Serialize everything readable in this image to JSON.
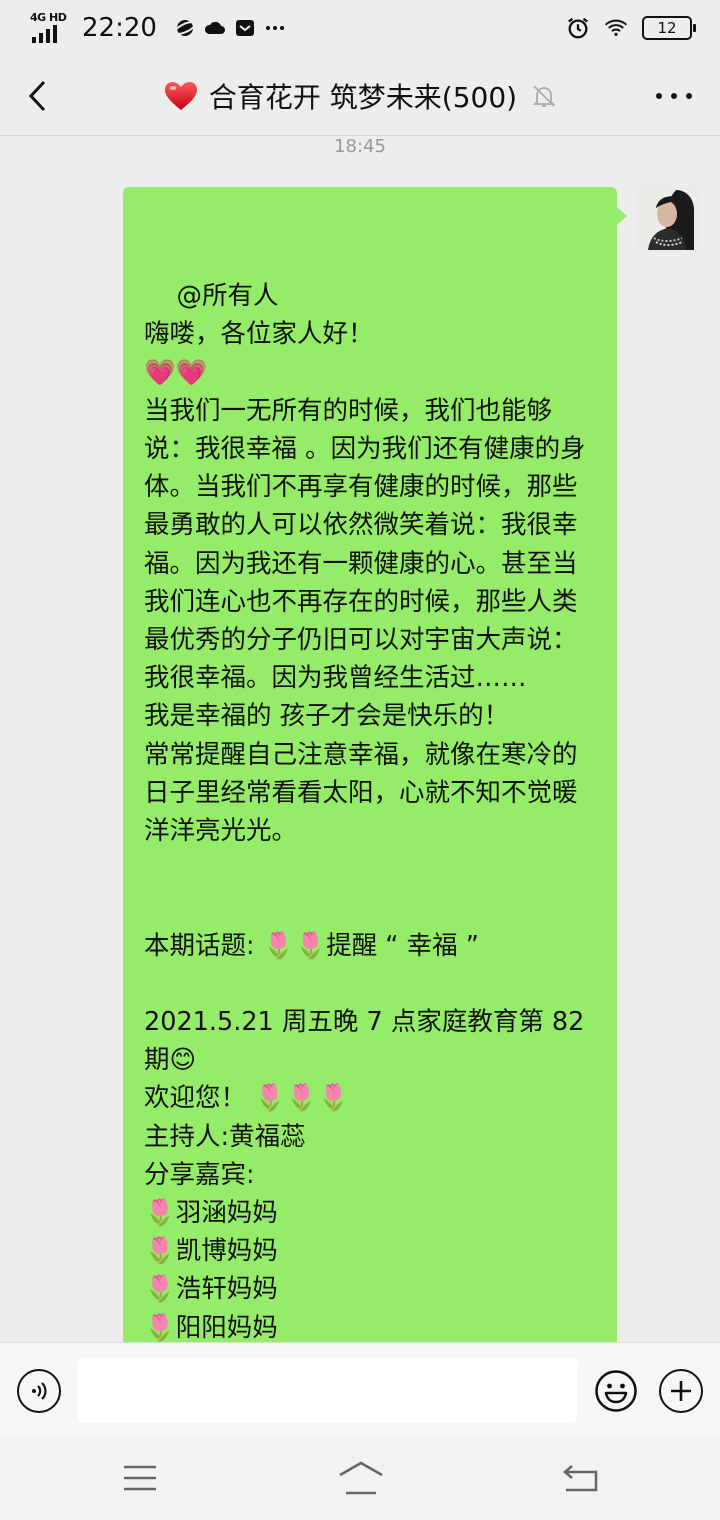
{
  "status_bar": {
    "network": "4G HD",
    "time": "22:20",
    "battery": "12",
    "icons": [
      "planet-icon",
      "cloud-icon",
      "mail-icon",
      "more-dots-icon",
      "alarm-icon",
      "wifi-icon",
      "battery-icon"
    ]
  },
  "header": {
    "title": "合育花开 筑梦未来(500)",
    "icons": [
      "back-arrow-icon",
      "heart-emoji-icon",
      "mute-bell-icon",
      "more-icon"
    ]
  },
  "chat": {
    "timestamp": "18:45",
    "messages": [
      {
        "sender": "self",
        "text": "@所有人\n嗨喽，各位家人好！\n💗💗\n当我们一无所有的时候，我们也能够说：我很幸福 。因为我们还有健康的身体。当我们不再享有健康的时候，那些最勇敢的人可以依然微笑着说：我很幸福。因为我还有一颗健康的心。甚至当我们连心也不再存在的时候，那些人类最优秀的分子仍旧可以对宇宙大声说：我很幸福。因为我曾经生活过……\n我是幸福的 孩子才会是快乐的！\n常常提醒自己注意幸福，就像在寒冷的日子里经常看看太阳，心就不知不觉暖洋洋亮光光。\n\n\n本期话题: 🌷🌷提醒 “ 幸福 ”\n\n2021.5.21 周五晚 7 点家庭教育第 82 期😊\n欢迎您！ 🌷🌷🌷\n主持人:黄福蕊\n分享嘉宾:\n🌷羽涵妈妈\n🌷凯博妈妈\n🌷浩轩妈妈\n🌷阳阳妈妈"
      }
    ]
  },
  "input_bar": {
    "value": "",
    "placeholder": "",
    "icons": [
      "voice-icon",
      "emoji-icon",
      "plus-icon"
    ]
  },
  "nav_bar": {
    "icons": [
      "menu-icon",
      "home-icon",
      "back-icon"
    ]
  },
  "colors": {
    "background": "#ededed",
    "bubble": "#95ec69",
    "timestamp": "#999999"
  }
}
